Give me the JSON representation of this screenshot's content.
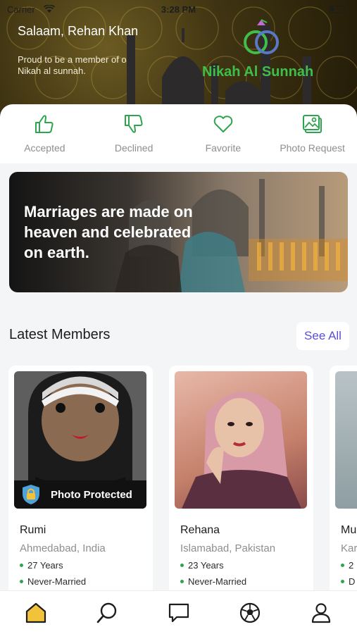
{
  "status_bar": {
    "carrier": "Carrier",
    "time": "3:28 PM"
  },
  "header": {
    "greeting": "Salaam, Rehan Khan",
    "subtitle": "Proud to be a member of our Nikah al sunnah.",
    "logo_text": "Nikah Al Sunnah"
  },
  "actions": [
    {
      "label": "Accepted",
      "icon": "thumbs-up-icon"
    },
    {
      "label": "Declined",
      "icon": "thumbs-down-icon"
    },
    {
      "label": "Favorite",
      "icon": "heart-icon"
    },
    {
      "label": "Photo Request",
      "icon": "photo-icon"
    }
  ],
  "banner": {
    "text": "Marriages are made on heaven and celebrated on earth."
  },
  "members": {
    "title": "Latest Members",
    "see_all": "See All",
    "cards": [
      {
        "name": "Rumi",
        "location": "Ahmedabad, India",
        "age": "27 Years",
        "status": "Never-Married",
        "photo_protected": "Photo Protected"
      },
      {
        "name": "Rehana",
        "location": "Islamabad, Pakistan",
        "age": "23 Years",
        "status": "Never-Married"
      },
      {
        "name": "Mu",
        "location": "Kar",
        "age": "2",
        "status": "D"
      }
    ]
  },
  "tabbar": [
    {
      "name": "home",
      "icon": "home-icon"
    },
    {
      "name": "search",
      "icon": "search-icon"
    },
    {
      "name": "chat",
      "icon": "chat-icon"
    },
    {
      "name": "discover",
      "icon": "soccer-ball-icon"
    },
    {
      "name": "profile",
      "icon": "profile-icon"
    }
  ],
  "colors": {
    "accent_green": "#2ea44f",
    "logo_green": "#3fbf4a",
    "see_all": "#5a4fd0",
    "tab_active": "#f2c23a"
  }
}
